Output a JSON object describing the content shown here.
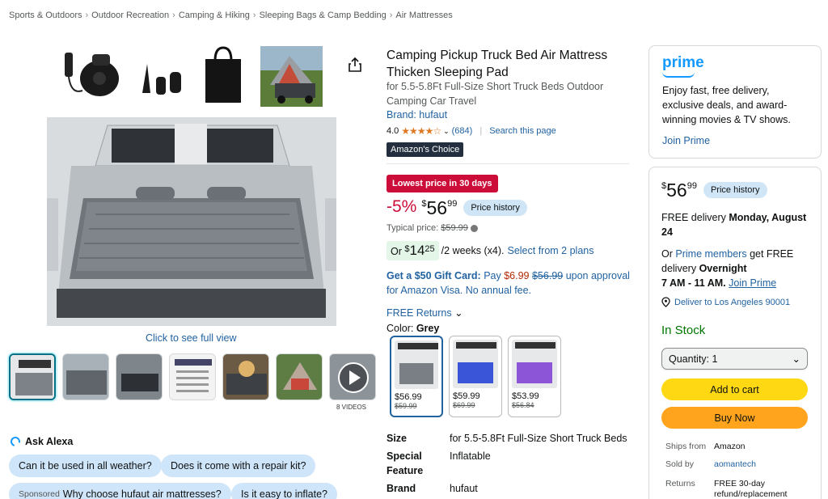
{
  "breadcrumb": [
    "Sports & Outdoors",
    "Outdoor Recreation",
    "Camping & Hiking",
    "Sleeping Bags & Camp Bedding",
    "Air Mattresses"
  ],
  "breadcrumb_sep": "›",
  "gallery": {
    "click_to_see": "Click to see full view",
    "videos_label": "8 VIDEOS"
  },
  "product": {
    "title": "Camping Pickup Truck Bed Air Mattress Thicken Sleeping Pad",
    "subtitle": "for 5.5-5.8Ft Full-Size Short Truck Beds Outdoor Camping Car Travel",
    "brand": "Brand: hufaut",
    "rating_value": "4.0",
    "stars": "★★★★☆",
    "rating_count": "(684)",
    "search_page": "Search this page",
    "choice_badge": "Amazon's Choice",
    "deal_badge": "Lowest price in 30 days",
    "discount": "-5%",
    "price_symbol": "$",
    "price_whole": "56",
    "price_fraction": "99",
    "price_history": "Price history",
    "typical_label": "Typical price:",
    "typical_price": "$59.99",
    "installment_prefix": "Or",
    "installment_whole": "14",
    "installment_fraction": "25",
    "installment_suffix": "/2 weeks (x4).",
    "installment_link": "Select from 2 plans",
    "gift_bold": "Get a $50 Gift Card:",
    "gift_pay": "Pay",
    "gift_new": "$6.99",
    "gift_old": "$56.99",
    "gift_rest": "upon approval for Amazon Visa. No annual fee.",
    "free_returns": "FREE Returns",
    "color_label": "Color:",
    "color_value": "Grey",
    "swatches": [
      {
        "price": "$56.99",
        "old": "$59.99",
        "color": "#7a7f86"
      },
      {
        "price": "$59.99",
        "old": "$69.99",
        "color": "#3b55d8"
      },
      {
        "price": "$53.99",
        "old": "$56.84",
        "color": "#8c55d8"
      }
    ],
    "specs": [
      {
        "k": "Size",
        "v": "for 5.5-5.8Ft Full-Size Short Truck Beds"
      },
      {
        "k": "Special Feature",
        "v": "Inflatable"
      },
      {
        "k": "Brand",
        "v": "hufaut"
      }
    ]
  },
  "alexa": {
    "title": "Ask Alexa",
    "q1": "Can it be used in all weather?",
    "q2": "Does it come with a repair kit?",
    "sponsored": "Sponsored",
    "q3": "Why choose hufaut air mattresses?",
    "q4": "Is it easy to inflate?"
  },
  "prime": {
    "logo": "prime",
    "text": "Enjoy fast, free delivery, exclusive deals, and award-winning movies & TV shows.",
    "join": "Join Prime"
  },
  "buybox": {
    "price_symbol": "$",
    "price_whole": "56",
    "price_fraction": "99",
    "price_history": "Price history",
    "free_delivery": "FREE delivery",
    "delivery_date": "Monday, August 24",
    "or": "Or",
    "prime_members": "Prime members",
    "get_free": "get FREE delivery",
    "overnight": "Overnight",
    "window": "7 AM - 11 AM.",
    "join_prime": "Join Prime",
    "deliver_to": "Deliver to Los Angeles 90001",
    "stock": "In Stock",
    "quantity": "Quantity: 1",
    "add_to_cart": "Add to cart",
    "buy_now": "Buy Now",
    "ships_from_label": "Ships from",
    "ships_from": "Amazon",
    "sold_by_label": "Sold by",
    "sold_by": "aomantech",
    "returns_label": "Returns",
    "returns": "FREE 30-day refund/replacement"
  },
  "colors": {
    "link": "#2162a1",
    "deal_red": "#cc0c39",
    "stock_green": "#007600",
    "cart_yellow": "#ffd814",
    "buy_orange": "#ffa41c",
    "pill_blue": "#d0e6f7",
    "prime_blue": "#1399ff",
    "choice_dark": "#232f3e"
  },
  "icons": [
    "share-icon",
    "play-icon",
    "chevron-down-icon",
    "location-pin-icon",
    "alexa-icon"
  ]
}
